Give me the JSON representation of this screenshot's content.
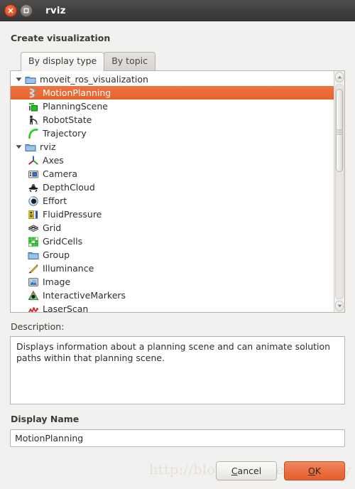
{
  "window": {
    "title": "rviz",
    "close_icon": "close-icon",
    "maximize_icon": "maximize-icon"
  },
  "dialog": {
    "heading": "Create visualization",
    "tabs": [
      {
        "label": "By display type",
        "active": true
      },
      {
        "label": "By topic",
        "active": false
      }
    ],
    "tree": {
      "groups": [
        {
          "label": "moveit_ros_visualization",
          "icon": "folder-icon",
          "expanded": true,
          "twisty": "triangle-down-icon",
          "items": [
            {
              "label": "MotionPlanning",
              "icon": "motion-planning-icon",
              "selected": true
            },
            {
              "label": "PlanningScene",
              "icon": "planning-scene-icon",
              "selected": false
            },
            {
              "label": "RobotState",
              "icon": "robot-state-icon",
              "selected": false
            },
            {
              "label": "Trajectory",
              "icon": "trajectory-icon",
              "selected": false
            }
          ]
        },
        {
          "label": "rviz",
          "icon": "folder-icon",
          "expanded": true,
          "twisty": "triangle-down-icon",
          "items": [
            {
              "label": "Axes",
              "icon": "axes-icon",
              "selected": false
            },
            {
              "label": "Camera",
              "icon": "camera-icon",
              "selected": false
            },
            {
              "label": "DepthCloud",
              "icon": "depth-cloud-icon",
              "selected": false
            },
            {
              "label": "Effort",
              "icon": "effort-icon",
              "selected": false
            },
            {
              "label": "FluidPressure",
              "icon": "fluid-pressure-icon",
              "selected": false
            },
            {
              "label": "Grid",
              "icon": "grid-icon",
              "selected": false
            },
            {
              "label": "GridCells",
              "icon": "grid-cells-icon",
              "selected": false
            },
            {
              "label": "Group",
              "icon": "folder-icon",
              "selected": false
            },
            {
              "label": "Illuminance",
              "icon": "illuminance-icon",
              "selected": false
            },
            {
              "label": "Image",
              "icon": "image-icon",
              "selected": false
            },
            {
              "label": "InteractiveMarkers",
              "icon": "interactive-markers-icon",
              "selected": false
            },
            {
              "label": "LaserScan",
              "icon": "laser-scan-icon",
              "selected": false
            }
          ]
        }
      ],
      "scrollbar": {
        "up_icon": "scroll-up-icon",
        "down_icon": "scroll-down-icon",
        "thumb_top_percent": 2,
        "thumb_height_percent": 39
      }
    },
    "description": {
      "label": "Description:",
      "text": "Displays information about a planning scene and can animate solution paths within that planning scene."
    },
    "display_name": {
      "label": "Display Name",
      "value": "MotionPlanning",
      "placeholder": ""
    },
    "buttons": {
      "cancel": {
        "pre": "",
        "accel": "C",
        "post": "ancel"
      },
      "ok": {
        "pre": "",
        "accel": "O",
        "post": "K"
      }
    }
  },
  "watermark": {
    "text": "http://blog.csdn.net/wx_amy"
  },
  "colors": {
    "selection": "#e8632a",
    "ok_button": "#ea7044",
    "titlebar": "#413f3d",
    "dialog_bg": "#f2f1f0"
  }
}
